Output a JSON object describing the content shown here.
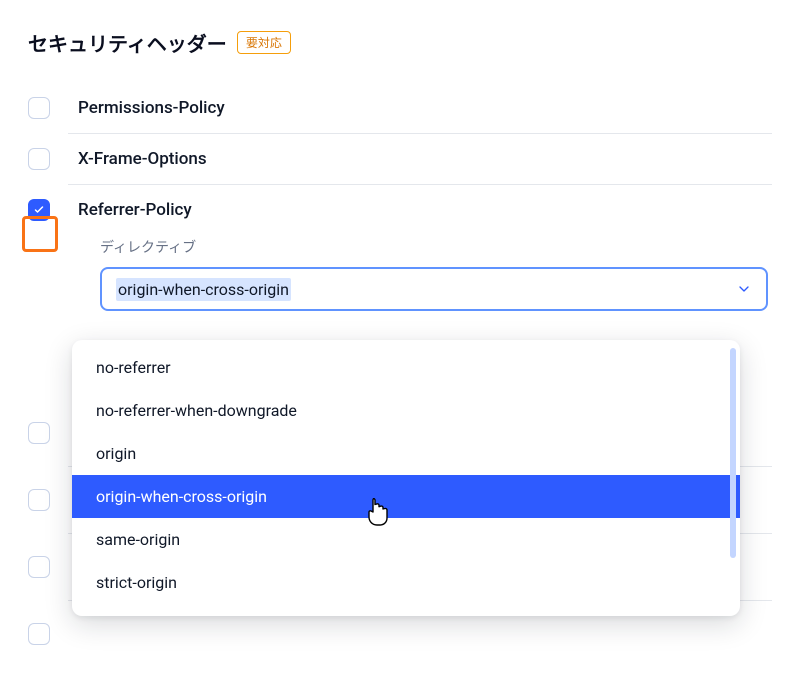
{
  "section": {
    "title": "セキュリティヘッダー",
    "badge": "要対応"
  },
  "headers": [
    {
      "name": "Permissions-Policy",
      "checked": false
    },
    {
      "name": "X-Frame-Options",
      "checked": false
    },
    {
      "name": "Referrer-Policy",
      "checked": true,
      "highlight": true
    }
  ],
  "directive": {
    "label": "ディレクティブ",
    "selected": "origin-when-cross-origin",
    "options": [
      "no-referrer",
      "no-referrer-when-downgrade",
      "origin",
      "origin-when-cross-origin",
      "same-origin",
      "strict-origin"
    ],
    "hover_index": 3
  },
  "colors": {
    "accent": "#2e5bff",
    "highlight_border": "#f97316",
    "badge_border": "#f59e0b",
    "badge_text": "#d97706"
  }
}
